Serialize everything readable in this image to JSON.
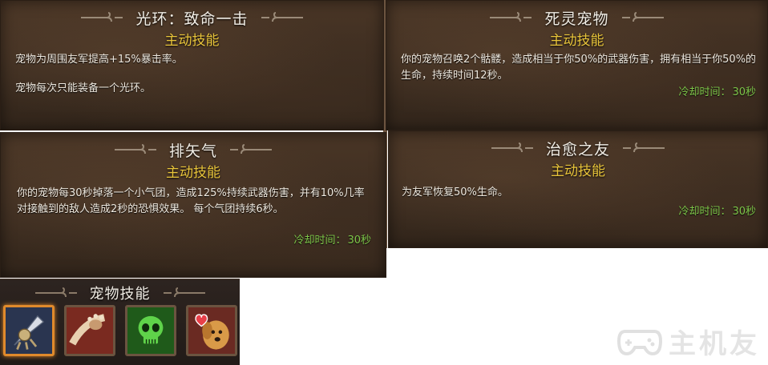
{
  "panels": [
    {
      "title": "光环：致命一击",
      "type": "主动技能",
      "lines": [
        "宠物为周围友军提高+15%暴击率。",
        "宠物每次只能装备一个光环。"
      ]
    },
    {
      "title": "死灵宠物",
      "type": "主动技能",
      "lines": [
        "你的宠物召唤2个骷髅，造成相当于你50%的武器伤害，拥有相当于你50%的生命，持续时间12秒。"
      ],
      "cooldown_label": "冷却时间：",
      "cooldown_value": "30秒"
    },
    {
      "title": "排矢气",
      "type": "主动技能",
      "lines": [
        "你的宠物每30秒掉落一个小气团，造成125%持续武器伤害，并有10%几率对接触到的敌人造成2秒的恐惧效果。 每个气团持续6秒。"
      ],
      "cooldown_label": "冷却时间：",
      "cooldown_value": "30秒"
    },
    {
      "title": "治愈之友",
      "type": "主动技能",
      "lines": [
        "为友军恢复50%生命。"
      ],
      "cooldown_label": "冷却时间：",
      "cooldown_value": "30秒"
    }
  ],
  "skillbar": {
    "title": "宠物技能",
    "slots": [
      {
        "icon": "crit-aura-icon",
        "selected": true
      },
      {
        "icon": "paw-claw-icon",
        "selected": false
      },
      {
        "icon": "skull-icon",
        "selected": false
      },
      {
        "icon": "dog-heart-icon",
        "selected": false
      }
    ]
  },
  "watermark": {
    "text": "主机友"
  },
  "colors": {
    "skill_type": "#e8c43a",
    "cooldown": "#7fc74a",
    "selected_border": "#e08a2c"
  }
}
